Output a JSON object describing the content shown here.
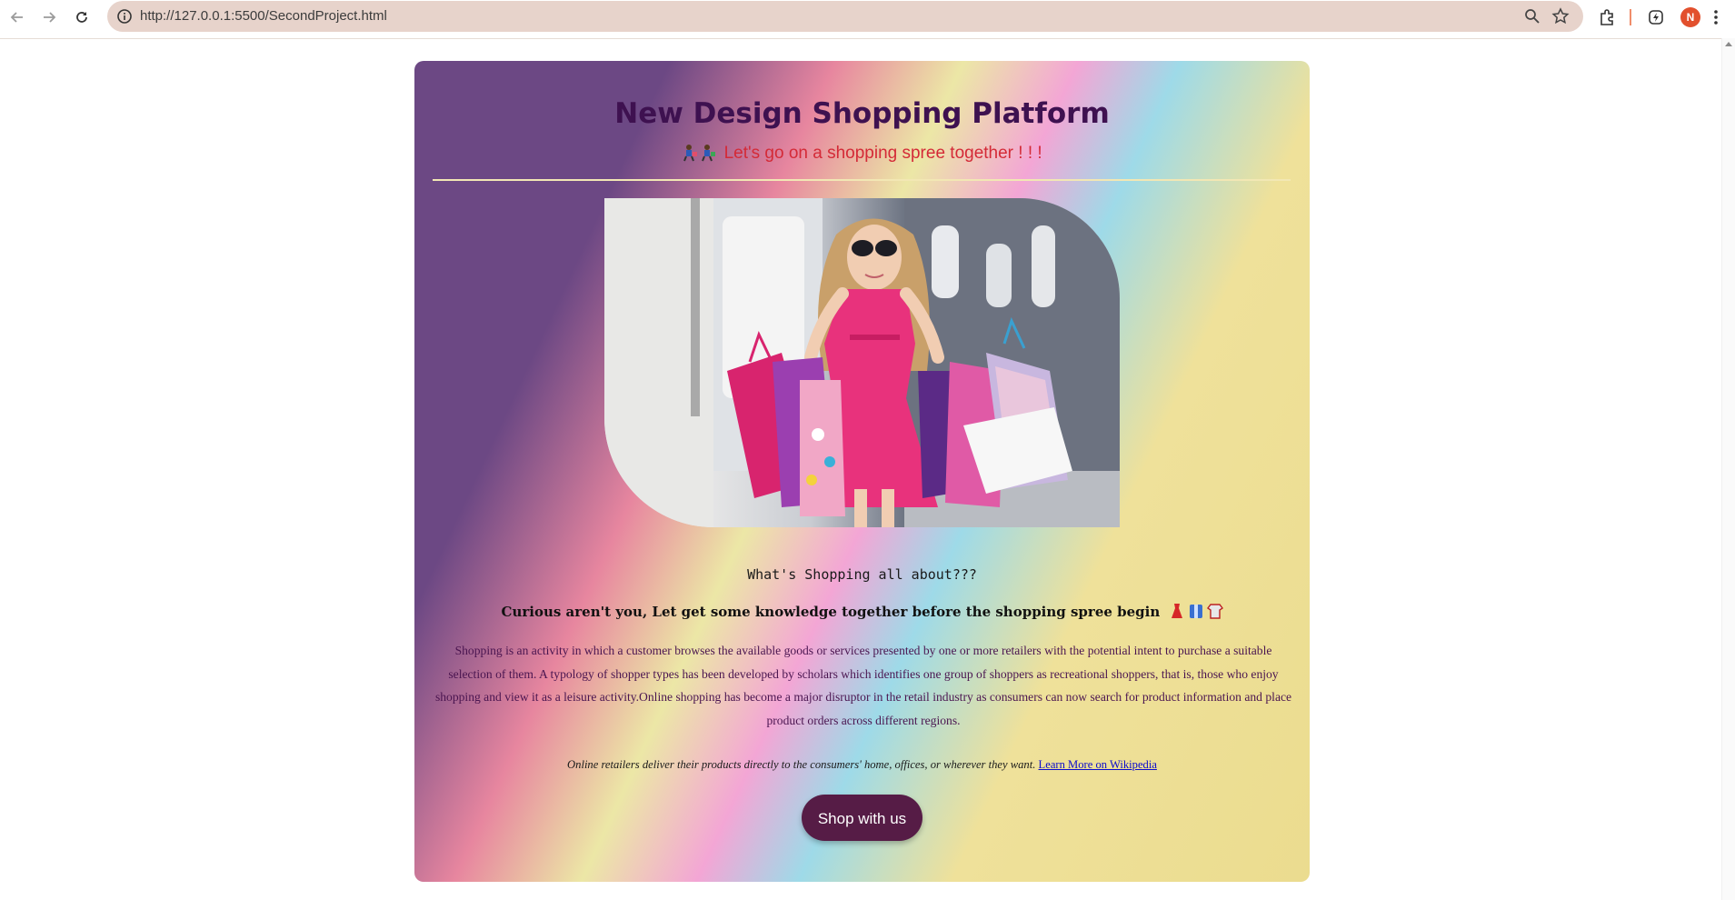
{
  "browser": {
    "url": "http://127.0.0.1:5500/SecondProject.html",
    "profile_initial": "N",
    "accent_color": "#e2502d"
  },
  "page": {
    "title": "New Design Shopping Platform",
    "tagline": "Let's go on a shopping spree together ! ! !",
    "section_heading": "What's Shopping all about???",
    "curious_line": "Curious aren't you, Let get some knowledge together before the shopping spree begin",
    "paragraph": "Shopping is an activity in which a customer browses the available goods or services presented by one or more retailers with the potential intent to purchase a suitable selection of them. A typology of shopper types has been developed by scholars which identifies one group of shoppers as recreational shoppers, that is, those who enjoy shopping and view it as a leisure activity.Online shopping has become a major disruptor in the retail industry as consumers can now search for product information and place product orders across different regions.",
    "retail_note": "Online retailers deliver their products directly to the consumers' home, offices, or wherever they want.",
    "wiki_link": "Learn More on Wikipedia",
    "cta_label": "Shop with us",
    "colors": {
      "title": "#3e1150",
      "tagline": "#d42a37",
      "paragraph": "#4a1550",
      "button": "#561c46"
    }
  }
}
